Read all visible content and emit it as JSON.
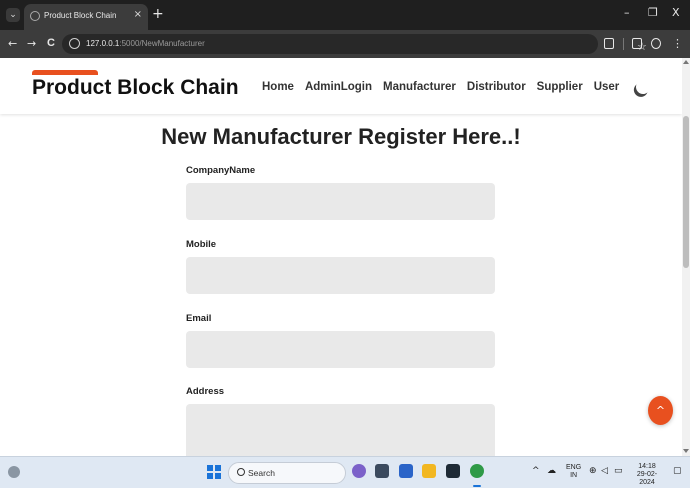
{
  "browser": {
    "tab_title": "Product Block Chain",
    "tab_close": "×",
    "new_tab": "+",
    "tab_menu": "⌄",
    "url_host": "127.0.0.1",
    "url_path": ":5000/NewManufacturer",
    "back": "←",
    "forward": "→",
    "reload": "C",
    "bookmark": "☆",
    "menu": "⋮",
    "window_minimize": "–",
    "window_restore": "❐",
    "window_close": "X"
  },
  "site": {
    "brand": "Product Block Chain",
    "brand_color": "#e8501f",
    "nav": [
      "Home",
      "AdminLogin",
      "Manufacturer",
      "Distributor",
      "Supplier",
      "User"
    ],
    "theme_toggle_icon": "moon-icon"
  },
  "form": {
    "title": "New Manufacturer Register Here..!",
    "fields": [
      {
        "label": "CompanyName",
        "value": ""
      },
      {
        "label": "Mobile",
        "value": ""
      },
      {
        "label": "Email",
        "value": ""
      },
      {
        "label": "Address",
        "value": ""
      }
    ]
  },
  "scroll_top_icon": "^",
  "taskbar": {
    "search_placeholder": "Search",
    "language_line1": "ENG",
    "language_line2": "IN",
    "time": "14:18",
    "date": "29-02-2024"
  }
}
